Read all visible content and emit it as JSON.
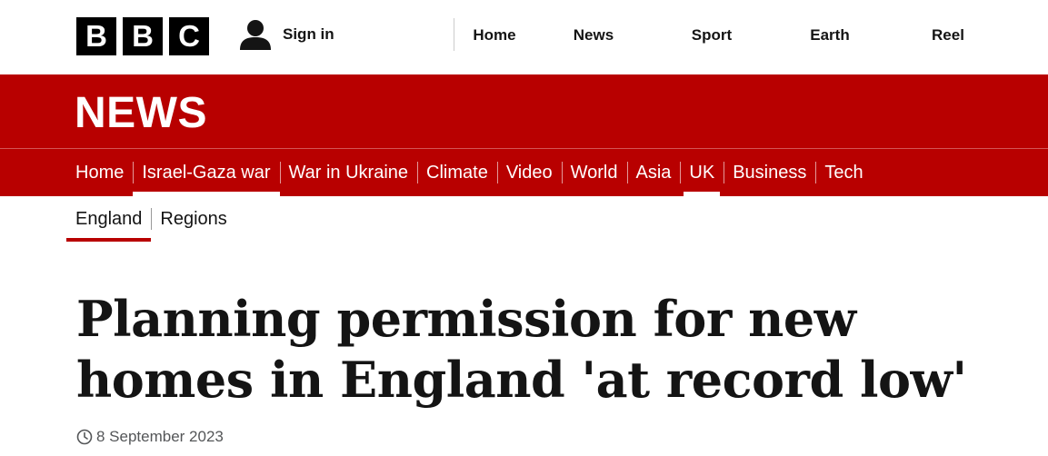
{
  "header": {
    "logo_letters": [
      "B",
      "B",
      "C"
    ],
    "sign_in_label": "Sign in",
    "nav": [
      "Home",
      "News",
      "Sport",
      "Earth",
      "Reel"
    ]
  },
  "banner": {
    "title": "NEWS"
  },
  "section_nav": {
    "items": [
      "Home",
      "Israel-Gaza war",
      "War in Ukraine",
      "Climate",
      "Video",
      "World",
      "Asia",
      "UK",
      "Business",
      "Tech"
    ]
  },
  "sub_nav": {
    "items": [
      "England",
      "Regions"
    ]
  },
  "article": {
    "headline": "Planning permission for new homes in England 'at record low'",
    "date": "8 September 2023"
  },
  "colors": {
    "brand_red": "#b80000",
    "logo_black": "#000000"
  },
  "icons": {
    "user": "user-icon",
    "clock": "clock-icon"
  }
}
